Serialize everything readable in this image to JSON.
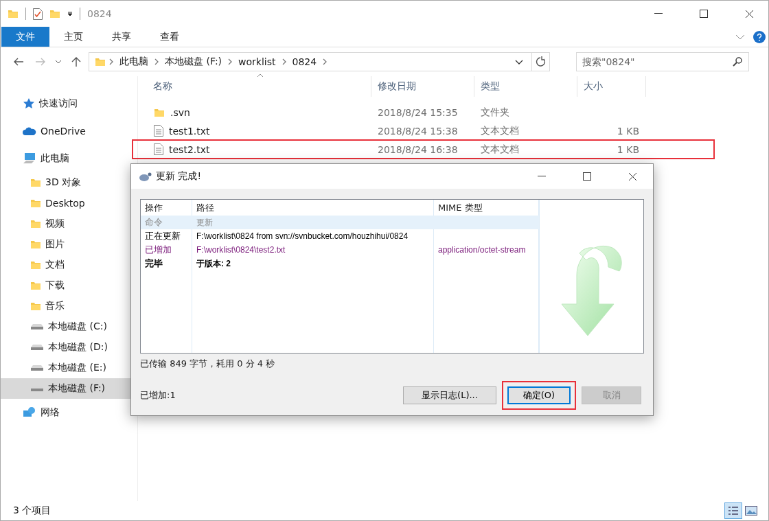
{
  "window": {
    "title": "0824"
  },
  "ribbon_tabs": [
    {
      "label": "文件",
      "selected": true
    },
    {
      "label": "主页",
      "selected": false
    },
    {
      "label": "共享",
      "selected": false
    },
    {
      "label": "查看",
      "selected": false
    }
  ],
  "breadcrumb": [
    "此电脑",
    "本地磁盘 (F:)",
    "worklist",
    "0824"
  ],
  "search": {
    "placeholder": "搜索\"0824\""
  },
  "sidebar": [
    {
      "label": "快速访问",
      "kind": "star",
      "selected": false
    },
    {
      "label": "OneDrive",
      "kind": "cloud",
      "selected": false
    },
    {
      "label": "此电脑",
      "kind": "pc",
      "selected": false,
      "children": [
        {
          "label": "3D 对象",
          "kind": "folder",
          "selected": false
        },
        {
          "label": "Desktop",
          "kind": "folder",
          "selected": false
        },
        {
          "label": "视频",
          "kind": "folder",
          "selected": false
        },
        {
          "label": "图片",
          "kind": "folder",
          "selected": false
        },
        {
          "label": "文档",
          "kind": "folder",
          "selected": false
        },
        {
          "label": "下载",
          "kind": "folder",
          "selected": false
        },
        {
          "label": "音乐",
          "kind": "folder",
          "selected": false
        },
        {
          "label": "本地磁盘 (C:)",
          "kind": "drive",
          "selected": false
        },
        {
          "label": "本地磁盘 (D:)",
          "kind": "drive",
          "selected": false
        },
        {
          "label": "本地磁盘 (E:)",
          "kind": "drive",
          "selected": false
        },
        {
          "label": "本地磁盘 (F:)",
          "kind": "drive",
          "selected": true
        }
      ]
    },
    {
      "label": "网络",
      "kind": "network",
      "selected": false
    }
  ],
  "file_columns": [
    "名称",
    "修改日期",
    "类型",
    "大小"
  ],
  "files": [
    {
      "name": ".svn",
      "modified": "2018/8/24 15:35",
      "type": "文件夹",
      "kind": "folder",
      "highlighted": false
    },
    {
      "name": "test1.txt",
      "modified": "2018/8/24 15:38",
      "type": "文本文档",
      "size": "1 KB",
      "kind": "text",
      "highlighted": false
    },
    {
      "name": "test2.txt",
      "modified": "2018/8/24 16:38",
      "type": "文本文档",
      "size": "1 KB",
      "kind": "text",
      "highlighted": true
    }
  ],
  "status_bar": {
    "count": "3 个项目"
  },
  "dialog": {
    "title": "更新 完成!",
    "columns": [
      "操作",
      "路径",
      "MIME 类型"
    ],
    "rows": [
      {
        "kind": "command",
        "action": "命令",
        "path": "更新"
      },
      {
        "kind": "normal",
        "action": "正在更新",
        "path": "F:\\worklist\\0824 from svn://svnbucket.com/houzhihui/0824"
      },
      {
        "kind": "added",
        "action": "已增加",
        "path": "F:\\worklist\\0824\\test2.txt",
        "mime": "application/octet-stream"
      },
      {
        "kind": "done",
        "action": "完毕",
        "path": "于版本: 2"
      }
    ],
    "transfer": "已传输 849 字节，耗用 0 分 4 秒",
    "summary": "已增加:1",
    "buttons": [
      {
        "label": "显示日志(L)...",
        "disabled": false,
        "focused": false,
        "highlighted": false
      },
      {
        "label": "确定(O)",
        "disabled": false,
        "focused": true,
        "highlighted": true
      },
      {
        "label": "取消",
        "disabled": true,
        "focused": false,
        "highlighted": false
      }
    ]
  }
}
